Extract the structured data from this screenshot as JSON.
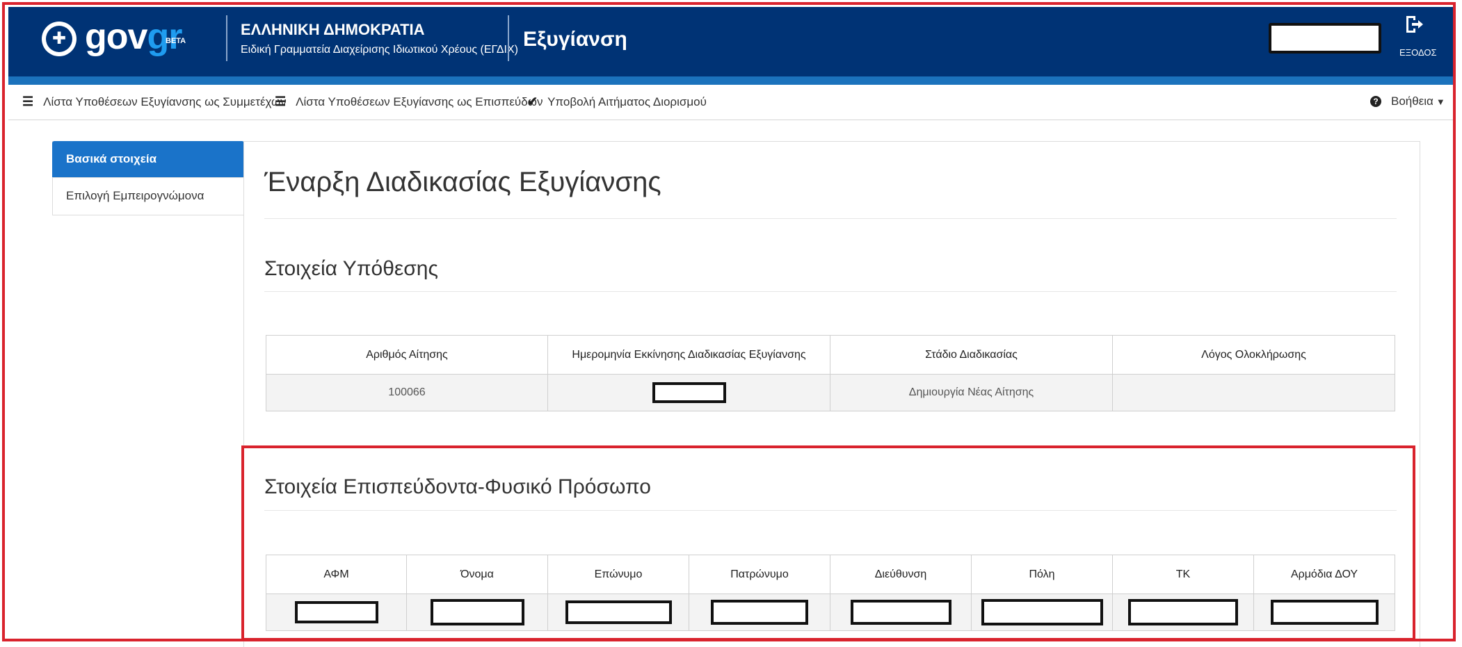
{
  "header": {
    "logo_main": "gov",
    "logo_accent": "gr",
    "beta_label": "BETA",
    "department_title": "ΕΛΛΗΝΙΚΗ ΔΗΜΟΚΡΑΤΙΑ",
    "department_subtitle": "Ειδική Γραμματεία Διαχείρισης Ιδιωτικού Χρέους (ΕΓΔΙΧ)",
    "app_title": "Εξυγίανση",
    "exit_label": "ΕΞΟΔΟΣ",
    "exit_icon": "logout-icon"
  },
  "navbar": {
    "items": [
      {
        "label": "Λίστα Υποθέσεων Εξυγίανσης ως Συμμετέχων",
        "icon": "list-icon"
      },
      {
        "label": "Λίστα Υποθέσεων Εξυγίανσης ως Επισπεύδων",
        "icon": "list-icon"
      },
      {
        "label": "Υποβολή Αιτήματος Διορισμού",
        "icon": "check-icon"
      }
    ],
    "help_label": "Βοήθεια"
  },
  "sidebar": {
    "items": [
      {
        "label": "Βασικά στοιχεία",
        "active": true
      },
      {
        "label": "Επιλογή Εμπειρογνώμονα",
        "active": false
      }
    ]
  },
  "main": {
    "page_title": "Έναρξη Διαδικασίας Εξυγίανσης",
    "case_section": {
      "title": "Στοιχεία Υπόθεσης",
      "columns": [
        "Αριθμός Αίτησης",
        "Ημερομηνία Εκκίνησης Διαδικασίας Εξυγίανσης",
        "Στάδιο Διαδικασίας",
        "Λόγος Ολοκλήρωσης"
      ],
      "row": {
        "application_number": "100066",
        "stage": "Δημιουργία Νέας Αίτησης",
        "completion_reason": ""
      }
    },
    "person_section": {
      "title": "Στοιχεία Επισπεύδοντα-Φυσικό Πρόσωπο",
      "columns": [
        "ΑΦΜ",
        "Όνομα",
        "Επώνυμο",
        "Πατρώνυμο",
        "Διεύθυνση",
        "Πόλη",
        "ΤΚ",
        "Αρμόδια ΔΟΥ"
      ]
    }
  },
  "colors": {
    "header_bg": "#003375",
    "header_stripe": "#1b72bc",
    "accent_blue": "#1a73c9",
    "highlight_red": "#d9232d"
  }
}
